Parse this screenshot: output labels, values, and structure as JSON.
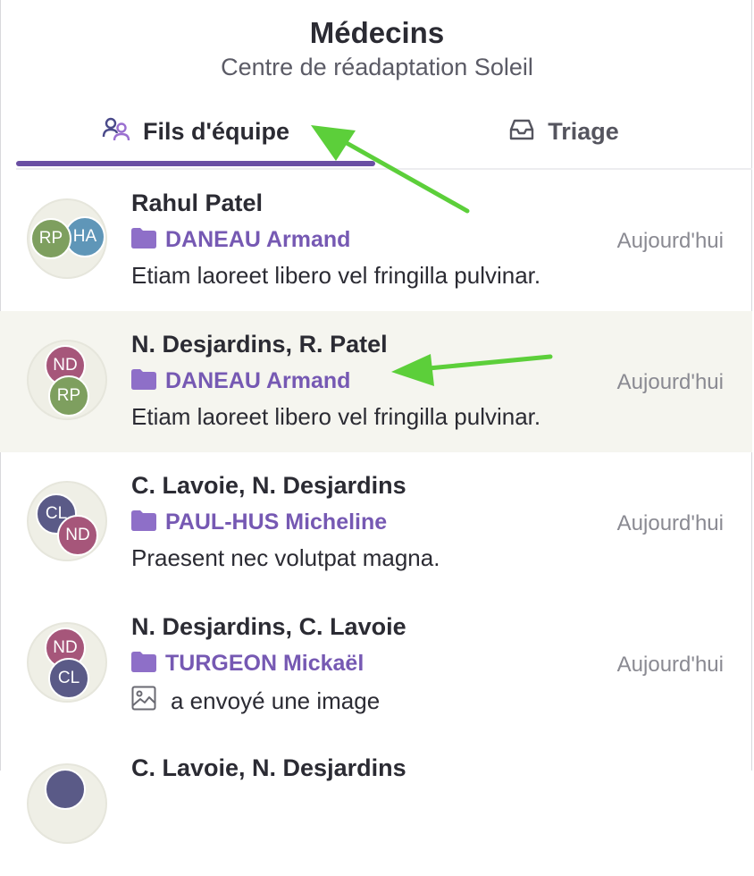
{
  "header": {
    "title": "Médecins",
    "subtitle": "Centre de réadaptation Soleil"
  },
  "tabs": [
    {
      "label": "Fils d'équipe",
      "icon": "team-icon",
      "active": true
    },
    {
      "label": "Triage",
      "icon": "inbox-icon",
      "active": false
    }
  ],
  "threads": [
    {
      "participants": "Rahul Patel",
      "patient": "DANEAU Armand",
      "date": "Aujourd'hui",
      "preview": "Etiam laoreet libero vel fringilla pulvinar.",
      "avatars": [
        {
          "initials": "RP",
          "color": "#7e9f5f"
        },
        {
          "initials": "HA",
          "color": "#5f96b8"
        }
      ]
    },
    {
      "participants": "N. Desjardins, R. Patel",
      "patient": "DANEAU Armand",
      "date": "Aujourd'hui",
      "preview": "Etiam laoreet libero vel fringilla pulvinar.",
      "avatars": [
        {
          "initials": "ND",
          "color": "#a6567a"
        },
        {
          "initials": "RP",
          "color": "#7e9f5f"
        }
      ]
    },
    {
      "participants": "C. Lavoie, N. Desjardins",
      "patient": "PAUL-HUS Micheline",
      "date": "Aujourd'hui",
      "preview": "Praesent nec volutpat magna.",
      "avatars": [
        {
          "initials": "CL",
          "color": "#5a5a87"
        },
        {
          "initials": "ND",
          "color": "#a6567a"
        }
      ]
    },
    {
      "participants": "N. Desjardins, C. Lavoie",
      "patient": "TURGEON Mickaël",
      "date": "Aujourd'hui",
      "preview": "a envoyé une image",
      "avatars": [
        {
          "initials": "ND",
          "color": "#a6567a"
        },
        {
          "initials": "CL",
          "color": "#5a5a87"
        }
      ]
    },
    {
      "participants": "C. Lavoie, N. Desjardins",
      "avatars": [
        {
          "initials": "",
          "color": "#5a5a87"
        }
      ]
    }
  ],
  "colors": {
    "accent": "#6a4fa3",
    "patient": "#7659b3",
    "annotation_arrow": "#5ccf3a"
  }
}
